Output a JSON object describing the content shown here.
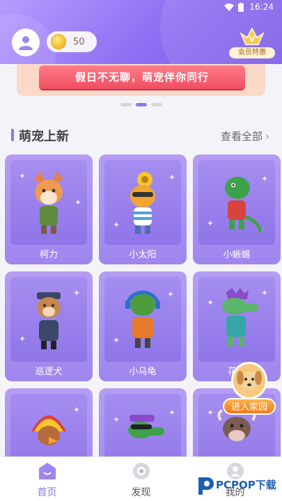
{
  "status_bar": {
    "time": "16:24"
  },
  "header": {
    "coins": "50",
    "vip_label": "会员特惠"
  },
  "banner": {
    "text": "假日不无聊，萌宠伴你同行",
    "slide_count": 3,
    "active_slide": 2
  },
  "section": {
    "title": "萌宠上新",
    "see_all": "查看全部"
  },
  "pets": [
    {
      "name": "柯力",
      "icon": "fox-pet-icon"
    },
    {
      "name": "小太阳",
      "icon": "sunflower-bird-pet-icon"
    },
    {
      "name": "小蜥蜴",
      "icon": "lizard-pet-icon"
    },
    {
      "name": "巡逻犬",
      "icon": "police-dog-pet-icon"
    },
    {
      "name": "小乌龟",
      "icon": "turtle-pet-icon"
    },
    {
      "name": "花花",
      "icon": "crocodile-pet-icon"
    },
    {
      "name": "",
      "icon": "chief-bird-pet-icon"
    },
    {
      "name": "",
      "icon": "cool-crocodile-pet-icon"
    },
    {
      "name": "",
      "icon": "cow-pet-icon"
    }
  ],
  "float_button": {
    "label": "进入家园"
  },
  "nav": [
    {
      "label": "首页",
      "icon": "home-icon",
      "active": true
    },
    {
      "label": "发现",
      "icon": "compass-icon",
      "active": false
    },
    {
      "label": "我的",
      "icon": "profile-icon",
      "active": false
    }
  ],
  "watermark": {
    "text": "PCPOP下载"
  },
  "colors": {
    "accent": "#8f76ef",
    "card": "#a58ef0",
    "banner_ribbon": "#f04e62",
    "home_button": "#f27a14"
  }
}
